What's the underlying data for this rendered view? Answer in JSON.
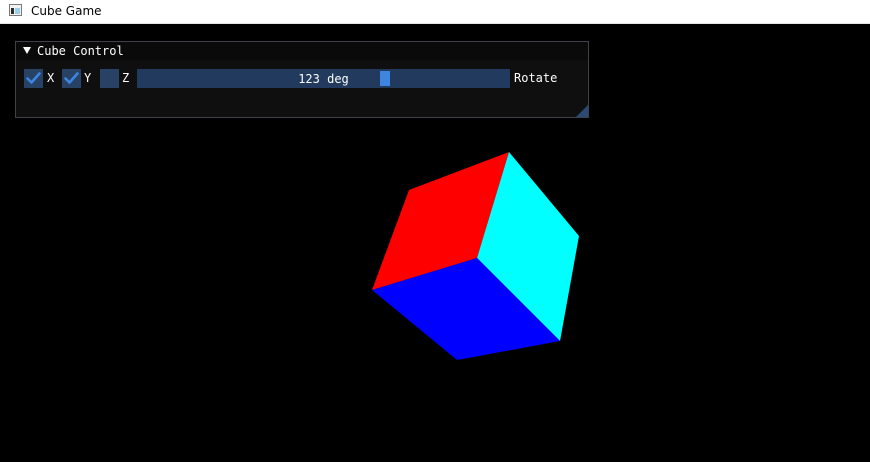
{
  "window": {
    "title": "Cube Game",
    "icon": "app-window-icon"
  },
  "panel": {
    "title": "Cube Control",
    "collapse_icon": "triangle-down-icon",
    "checkboxes": [
      {
        "label": "X",
        "checked": true
      },
      {
        "label": "Y",
        "checked": true
      },
      {
        "label": "Z",
        "checked": false
      }
    ],
    "slider": {
      "value_text": "123 deg",
      "value": 123,
      "label": "Rotate"
    },
    "resize_icon": "resize-grip-icon"
  },
  "scene": {
    "background": "#000000",
    "cube_faces": [
      {
        "name": "top-face",
        "color": "#ff0000"
      },
      {
        "name": "right-face",
        "color": "#00ffff"
      },
      {
        "name": "front-face",
        "color": "#0000ff"
      }
    ]
  },
  "colors": {
    "frame_bg": "#284266",
    "slider_bg": "#213a5e",
    "accent": "#3d85e0",
    "panel_bg": "#0f0f10"
  }
}
